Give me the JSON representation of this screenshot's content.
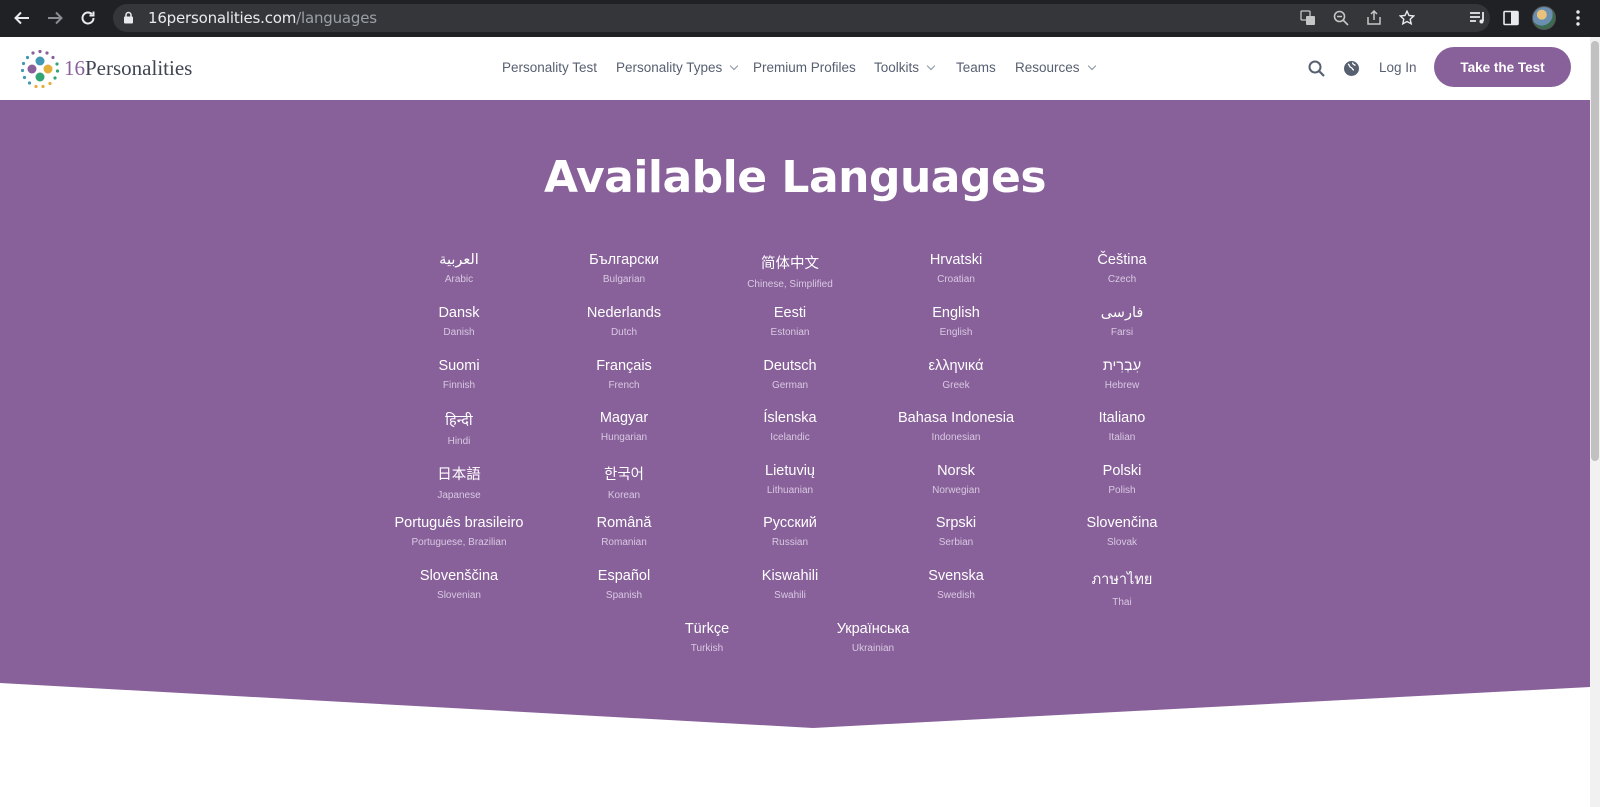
{
  "browser": {
    "url_host": "16personalities.com",
    "url_path": "/languages"
  },
  "site": {
    "logo_number": "16",
    "logo_word": "Personalities",
    "nav": [
      {
        "label": "Personality Test",
        "dropdown": false
      },
      {
        "label": "Personality Types",
        "dropdown": true
      },
      {
        "label": "Premium Profiles",
        "dropdown": false
      },
      {
        "label": "Toolkits",
        "dropdown": true
      },
      {
        "label": "Teams",
        "dropdown": false
      },
      {
        "label": "Resources",
        "dropdown": true
      }
    ],
    "login_label": "Log In",
    "cta_label": "Take the Test",
    "brand_color": "#88619a"
  },
  "hero": {
    "title": "Available Languages",
    "languages": [
      {
        "native": "العربية",
        "english": "Arabic"
      },
      {
        "native": "Български",
        "english": "Bulgarian"
      },
      {
        "native": "简体中文",
        "english": "Chinese, Simplified"
      },
      {
        "native": "Hrvatski",
        "english": "Croatian"
      },
      {
        "native": "Čeština",
        "english": "Czech"
      },
      {
        "native": "Dansk",
        "english": "Danish"
      },
      {
        "native": "Nederlands",
        "english": "Dutch"
      },
      {
        "native": "Eesti",
        "english": "Estonian"
      },
      {
        "native": "English",
        "english": "English"
      },
      {
        "native": "فارسی",
        "english": "Farsi"
      },
      {
        "native": "Suomi",
        "english": "Finnish"
      },
      {
        "native": "Français",
        "english": "French"
      },
      {
        "native": "Deutsch",
        "english": "German"
      },
      {
        "native": "ελληνικά",
        "english": "Greek"
      },
      {
        "native": "עִבְרִית",
        "english": "Hebrew"
      },
      {
        "native": "हिन्दी",
        "english": "Hindi"
      },
      {
        "native": "Magyar",
        "english": "Hungarian"
      },
      {
        "native": "Íslenska",
        "english": "Icelandic"
      },
      {
        "native": "Bahasa Indonesia",
        "english": "Indonesian"
      },
      {
        "native": "Italiano",
        "english": "Italian"
      },
      {
        "native": "日本語",
        "english": "Japanese"
      },
      {
        "native": "한국어",
        "english": "Korean"
      },
      {
        "native": "Lietuvių",
        "english": "Lithuanian"
      },
      {
        "native": "Norsk",
        "english": "Norwegian"
      },
      {
        "native": "Polski",
        "english": "Polish"
      },
      {
        "native": "Português brasileiro",
        "english": "Portuguese, Brazilian"
      },
      {
        "native": "Română",
        "english": "Romanian"
      },
      {
        "native": "Русский",
        "english": "Russian"
      },
      {
        "native": "Srpski",
        "english": "Serbian"
      },
      {
        "native": "Slovenčina",
        "english": "Slovak"
      },
      {
        "native": "Slovenščina",
        "english": "Slovenian"
      },
      {
        "native": "Español",
        "english": "Spanish"
      },
      {
        "native": "Kiswahili",
        "english": "Swahili"
      },
      {
        "native": "Svenska",
        "english": "Swedish"
      },
      {
        "native": "ภาษาไทย",
        "english": "Thai"
      },
      {
        "native": "Türkçe",
        "english": "Turkish"
      },
      {
        "native": "Українська",
        "english": "Ukrainian"
      }
    ]
  }
}
